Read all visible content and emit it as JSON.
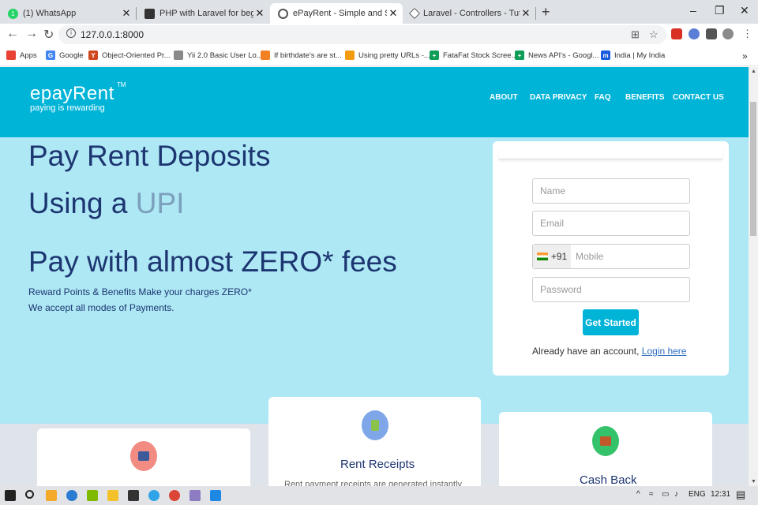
{
  "browser": {
    "tabs": [
      {
        "title": "(1) WhatsApp",
        "active": false,
        "icon": "whatsapp-icon",
        "color": "#25d366",
        "glyph": "1"
      },
      {
        "title": "PHP with Laravel for beginners -",
        "active": false,
        "icon": "video-icon",
        "color": "#333333",
        "glyph": ""
      },
      {
        "title": "ePayRent - Simple and Secure Re",
        "active": true,
        "icon": "globe-icon",
        "color": "#555555",
        "glyph": ""
      },
      {
        "title": "Laravel - Controllers - Tutorialsp",
        "active": false,
        "icon": "diamond-icon",
        "color": "#666666",
        "glyph": ""
      }
    ],
    "url": "127.0.0.1:8000",
    "bookmarks": [
      {
        "label": "Apps",
        "icon": "apps-grid-icon",
        "color": "#e94235"
      },
      {
        "label": "Google",
        "icon": "google-icon",
        "color": "#4285f4"
      },
      {
        "label": "Object-Oriented Pr...",
        "icon": "y-icon",
        "color": "#d0461f"
      },
      {
        "label": "Yii 2.0 Basic User Lo...",
        "icon": "feather-icon",
        "color": "#8a8a8a"
      },
      {
        "label": "If birthdate's are st...",
        "icon": "stackoverflow-icon",
        "color": "#f48024"
      },
      {
        "label": "Using pretty URLs -...",
        "icon": "wave-icon",
        "color": "#f39c12"
      },
      {
        "label": "FataFat Stock Scree...",
        "icon": "plus-green-icon",
        "color": "#0f9d58"
      },
      {
        "label": "News API's - Googl...",
        "icon": "plus-green-icon",
        "color": "#0f9d58"
      },
      {
        "label": "India | My India",
        "icon": "m-icon",
        "color": "#1a5ae0"
      }
    ]
  },
  "site": {
    "logo_name": "epayRent",
    "logo_tm": "TM",
    "logo_tagline": "paying is rewarding",
    "nav": [
      "ABOUT",
      "DATA PRIVACY",
      "FAQ",
      "BENEFITS",
      "CONTACT US"
    ],
    "hero": {
      "line1": "Pay Rent Deposits",
      "line2_prefix": "Using a ",
      "line2_highlight": "UPI",
      "line3": "Pay with almost ZERO* fees",
      "sub1": "Reward Points & Benefits Make your charges ZERO*",
      "sub2": "We accept all modes of Payments."
    },
    "form": {
      "name_placeholder": "Name",
      "email_placeholder": "Email",
      "country_code": "+91",
      "mobile_placeholder": "Mobile",
      "password_placeholder": "Password",
      "submit_label": "Get Started",
      "account_text": "Already have an account, ",
      "login_link": "Login here"
    },
    "cards": [
      {
        "title": "",
        "text": "",
        "icon": "card-payment-icon",
        "color": "#f28b82"
      },
      {
        "title": "Rent Receipts",
        "text": "Rent payment receipts are generated instantly",
        "icon": "receipt-icon",
        "color": "#7ea6e8"
      },
      {
        "title": "Cash Back",
        "text": "",
        "icon": "wallet-icon",
        "color": "#34c26b"
      }
    ]
  },
  "taskbar": {
    "lang": "ENG",
    "time": "12:31"
  }
}
